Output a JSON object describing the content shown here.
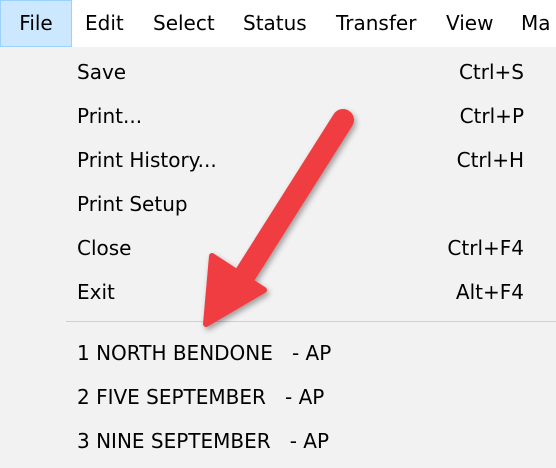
{
  "menubar": {
    "items": [
      {
        "label": "File"
      },
      {
        "label": "Edit"
      },
      {
        "label": "Select"
      },
      {
        "label": "Status"
      },
      {
        "label": "Transfer"
      },
      {
        "label": "View"
      },
      {
        "label": "Ma"
      }
    ]
  },
  "file_menu": {
    "items": [
      {
        "label": "Save",
        "shortcut": "Ctrl+S"
      },
      {
        "label": "Print...",
        "shortcut": "Ctrl+P"
      },
      {
        "label": "Print History...",
        "shortcut": "Ctrl+H"
      },
      {
        "label": "Print Setup",
        "shortcut": ""
      },
      {
        "label": "Close",
        "shortcut": "Ctrl+F4"
      },
      {
        "label": "Exit",
        "shortcut": "Alt+F4"
      }
    ],
    "recent": [
      {
        "label": "1 NORTH BENDONE   - AP"
      },
      {
        "label": "2 FIVE SEPTEMBER   - AP"
      },
      {
        "label": "3 NINE SEPTEMBER   - AP"
      }
    ]
  },
  "colors": {
    "arrow": "#ef3e42",
    "menu_background": "#f2f2f2",
    "active_menu_background": "#cce8ff"
  },
  "annotation": {
    "icon": "red-arrow-icon"
  }
}
